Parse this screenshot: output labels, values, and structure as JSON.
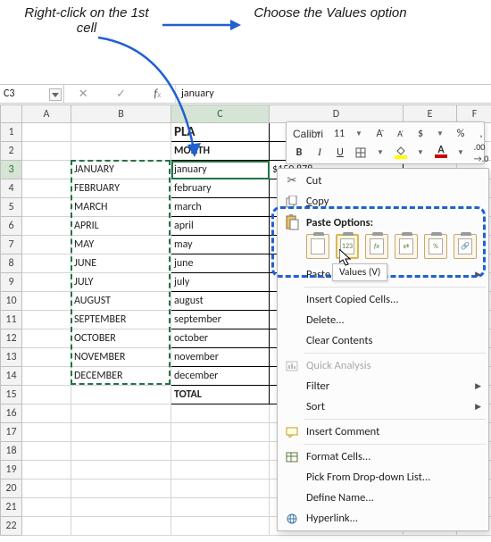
{
  "annotation": {
    "left": "Right-click on the 1st cell",
    "right": "Choose the Values option"
  },
  "name_box": {
    "value": "C3"
  },
  "formula_bar": {
    "value": "january"
  },
  "columns": [
    "A",
    "B",
    "C",
    "D",
    "E",
    "F"
  ],
  "row_numbers": [
    "1",
    "2",
    "3",
    "4",
    "5",
    "6",
    "7",
    "8",
    "9",
    "10",
    "11",
    "12",
    "13",
    "14",
    "15",
    "16",
    "17",
    "18",
    "19",
    "20",
    "21",
    "22"
  ],
  "cells": {
    "C1": "PLA",
    "C2": "MONTH",
    "D3": "$150 878",
    "C15": "TOTAL",
    "B": [
      "JANUARY",
      "FEBRUARY",
      "MARCH",
      "APRIL",
      "MAY",
      "JUNE",
      "JULY",
      "AUGUST",
      "SEPTEMBER",
      "OCTOBER",
      "NOVEMBER",
      "DECEMBER"
    ],
    "C": [
      "january",
      "february",
      "march",
      "april",
      "may",
      "june",
      "july",
      "august",
      "september",
      "october",
      "november",
      "december"
    ]
  },
  "mini_toolbar": {
    "font_name": "Calibri",
    "font_size": "11"
  },
  "context_menu": {
    "cut": "Cut",
    "copy": "Copy",
    "paste_heading": "Paste Options:",
    "paste_special": "Paste Special...",
    "insert_copied": "Insert Copied Cells...",
    "delete": "Delete...",
    "clear": "Clear Contents",
    "quick_analysis": "Quick Analysis",
    "filter": "Filter",
    "sort": "Sort",
    "insert_comment": "Insert Comment",
    "format_cells": "Format Cells...",
    "pick_list": "Pick From Drop-down List...",
    "define_name": "Define Name...",
    "hyperlink": "Hyperlink...",
    "paste_opts": {
      "paste": "",
      "values": "123",
      "formulas": "fx",
      "transpose": "⇄",
      "formatting": "%",
      "link": "🔗"
    }
  },
  "tooltip": {
    "values": "Values (V)"
  }
}
